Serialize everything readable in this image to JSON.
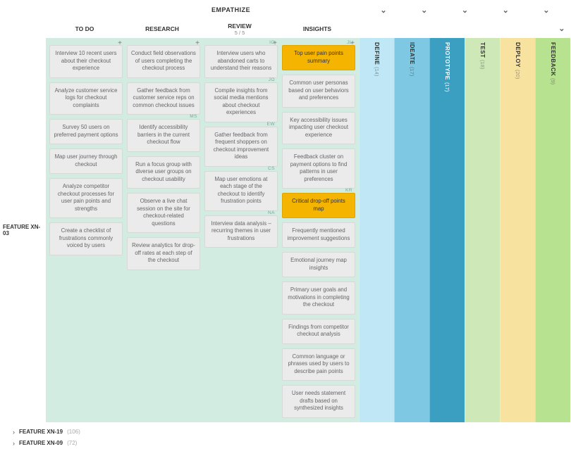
{
  "phase": {
    "title": "EMPATHIZE"
  },
  "columns": [
    {
      "label": "TO DO",
      "sub": ""
    },
    {
      "label": "RESEARCH",
      "sub": ""
    },
    {
      "label": "REVIEW",
      "sub": "5 / 5"
    },
    {
      "label": "INSIGHTS",
      "sub": ""
    }
  ],
  "row": {
    "label": "FEATURE XN-03"
  },
  "cards": {
    "todo": [
      {
        "text": "Interview 10 recent users about their checkout experience"
      },
      {
        "text": "Analyze customer service logs for checkout complaints"
      },
      {
        "text": "Survey 50 users on preferred payment options"
      },
      {
        "text": "Map user journey through checkout"
      },
      {
        "text": "Analyze competitor checkout processes for user pain points and strengths"
      },
      {
        "text": "Create a checklist of frustrations commonly voiced by users"
      }
    ],
    "research": [
      {
        "text": "Conduct field observations of users completing the checkout process"
      },
      {
        "text": "Gather feedback from customer service reps on common checkout issues"
      },
      {
        "text": "Identify accessibility barriers in the current checkout flow",
        "tag": "MS"
      },
      {
        "text": "Run a focus group with diverse user groups on checkout usability"
      },
      {
        "text": "Observe a live chat session on the site for checkout-related questions"
      },
      {
        "text": "Review analytics for drop-off rates at each step of the checkout"
      }
    ],
    "review": [
      {
        "text": "Interview users who abandoned carts to understand their reasons",
        "tag": "IO"
      },
      {
        "text": "Compile insights from social media mentions about checkout experiences",
        "tag": "JO"
      },
      {
        "text": "Gather feedback from frequent shoppers on checkout improvement ideas",
        "tag": "EW"
      },
      {
        "text": "Map user emotions at each stage of the checkout to identify frustration points",
        "tag": "CS"
      },
      {
        "text": "Interview data analysis – recurring themes in user frustrations",
        "tag": "NA"
      }
    ],
    "insights": [
      {
        "text": "Top user pain points summary",
        "hl": true,
        "tag": "JL"
      },
      {
        "text": "Common user personas based on user behaviors and preferences"
      },
      {
        "text": "Key accessibility issues impacting user checkout experience"
      },
      {
        "text": "Feedback cluster on payment options to find patterns in user preferences"
      },
      {
        "text": "Critical drop-off points map",
        "hl": true,
        "tag": "KR"
      },
      {
        "text": "Frequently mentioned improvement suggestions"
      },
      {
        "text": "Emotional journey map insights"
      },
      {
        "text": "Primary user goals and motivations in completing the checkout"
      },
      {
        "text": "Findings from competitor checkout analysis"
      },
      {
        "text": "Common language or phrases used by users to describe pain points"
      },
      {
        "text": "User needs statement drafts based on synthesized insights"
      }
    ]
  },
  "stages": [
    {
      "label": "DEFINE",
      "count": "(14)",
      "cls": "s-define"
    },
    {
      "label": "IDEATE",
      "count": "(17)",
      "cls": "s-ideate"
    },
    {
      "label": "PROTOTYPE",
      "count": "(17)",
      "cls": "s-proto"
    },
    {
      "label": "TEST",
      "count": "(18)",
      "cls": "s-test"
    },
    {
      "label": "DEPLOY",
      "count": "(20)",
      "cls": "s-deploy"
    },
    {
      "label": "FEEDBACK",
      "count": "(9)",
      "cls": "s-feedback"
    }
  ],
  "footer": [
    {
      "label": "FEATURE XN-19",
      "count": "(106)"
    },
    {
      "label": "FEATURE XN-09",
      "count": "(72)"
    }
  ],
  "glyph": {
    "add": "+",
    "chev_down": "⌄",
    "chev_right": "›"
  }
}
